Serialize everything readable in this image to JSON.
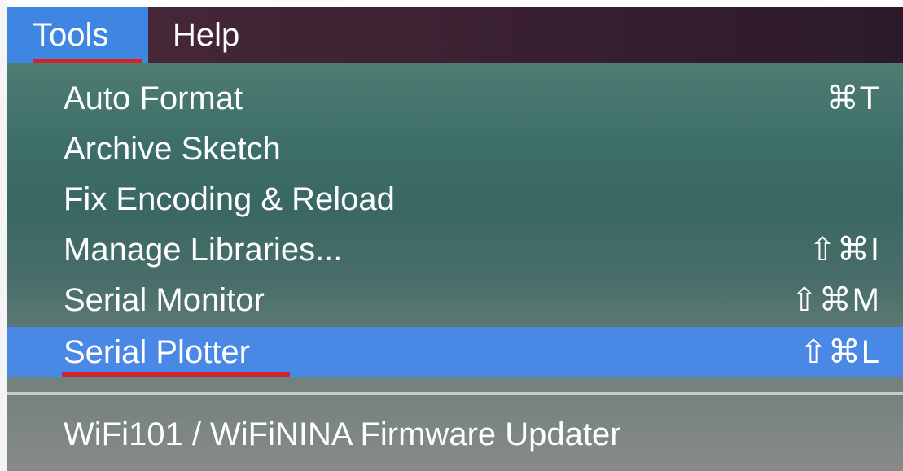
{
  "menubar": {
    "items": [
      {
        "label": "Tools",
        "active": true
      },
      {
        "label": "Help",
        "active": false
      }
    ]
  },
  "menu": {
    "items": [
      {
        "label": "Auto Format",
        "shortcut": "⌘T"
      },
      {
        "label": "Archive Sketch",
        "shortcut": ""
      },
      {
        "label": "Fix Encoding & Reload",
        "shortcut": ""
      },
      {
        "label": "Manage Libraries...",
        "shortcut": "⇧⌘I"
      },
      {
        "label": "Serial Monitor",
        "shortcut": "⇧⌘M"
      },
      {
        "label": "Serial Plotter",
        "shortcut": "⇧⌘L",
        "highlighted": true
      }
    ],
    "after_separator": [
      {
        "label": "WiFi101 / WiFiNINA Firmware Updater",
        "shortcut": ""
      }
    ]
  },
  "colors": {
    "highlight": "#4a88e6",
    "annotation_underline": "#d0232a",
    "menubar_active": "#3f86e3"
  }
}
